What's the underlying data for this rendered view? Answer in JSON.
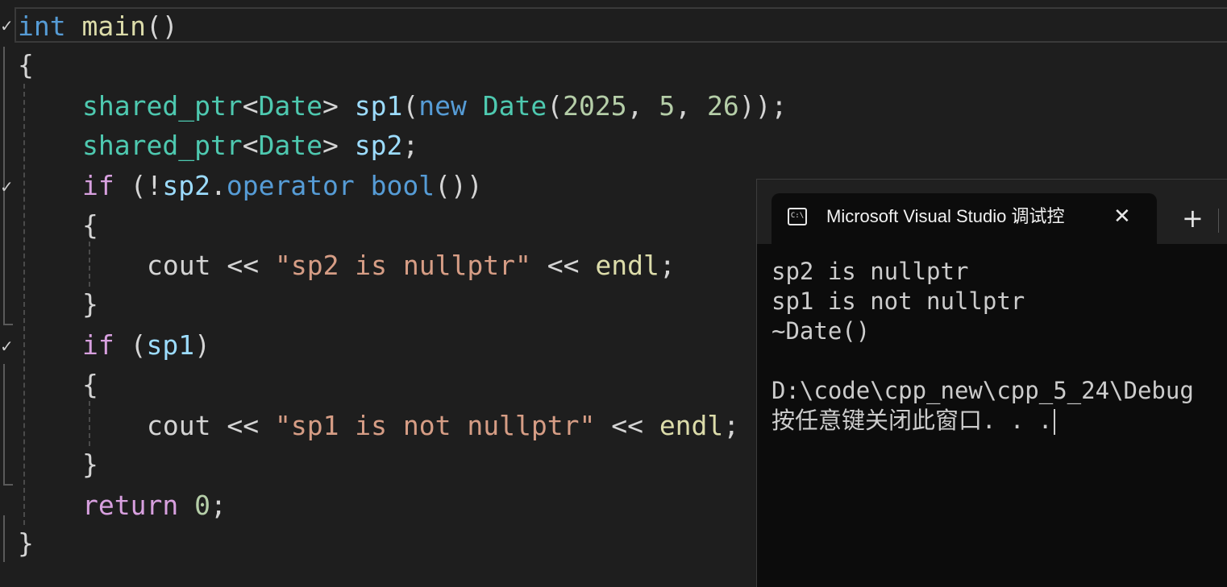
{
  "editor": {
    "code": {
      "l1": {
        "kw": "int",
        "fn": "main",
        "punct": "()"
      },
      "l2": {
        "brace": "{"
      },
      "l3": {
        "type1": "shared_ptr",
        "lt": "<",
        "type2": "Date",
        "gt": ">",
        "var": "sp1",
        "open": "(",
        "kw_new": "new",
        "type3": "Date",
        "paren": "(",
        "n1": "2025",
        "c1": ", ",
        "n2": "5",
        "c2": ", ",
        "n3": "26",
        "close": "));"
      },
      "l4": {
        "type1": "shared_ptr",
        "lt": "<",
        "type2": "Date",
        "gt": ">",
        "var": "sp2",
        "semi": ";"
      },
      "l5": {
        "ctl": "if",
        "open": " (!",
        "var": "sp2",
        "dot": ".",
        "kw_op": "operator",
        "kw_bool": "bool",
        "close": "())"
      },
      "l6": {
        "brace": "{"
      },
      "l7": {
        "cout": "cout",
        "op1": " << ",
        "str": "\"sp2 is nullptr\"",
        "op2": " << ",
        "fn": "endl",
        "semi": ";"
      },
      "l8": {
        "brace": "}"
      },
      "l9": {
        "ctl": "if",
        "open": " (",
        "var": "sp1",
        "close": ")"
      },
      "l10": {
        "brace": "{"
      },
      "l11": {
        "cout": "cout",
        "op1": " << ",
        "str": "\"sp1 is not nullptr\"",
        "op2": " << ",
        "fn": "endl",
        "semi": ";"
      },
      "l12": {
        "brace": "}"
      },
      "l13": {
        "ctl": "return",
        "num": "0",
        "semi": ";"
      },
      "l14": {
        "brace": "}"
      }
    },
    "check_mark": "✓"
  },
  "terminal": {
    "icon_text": "C:\\",
    "title": "Microsoft Visual Studio 调试控",
    "close_glyph": "✕",
    "new_tab_glyph": "+",
    "output": [
      "sp2 is nullptr",
      "sp1 is not nullptr",
      "~Date()",
      "",
      "D:\\code\\cpp_new\\cpp_5_24\\Debug",
      "按任意键关闭此窗口. . ."
    ]
  }
}
